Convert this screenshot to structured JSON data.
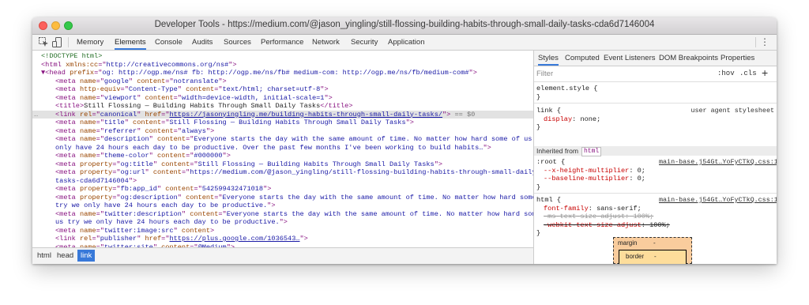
{
  "window": {
    "title": "Developer Tools - https://medium.com/@jason_yingling/still-flossing-building-habits-through-small-daily-tasks-cda6d7146004"
  },
  "toolbar": {
    "inspect_icon": "cursor-select-icon",
    "device_icon": "device-mode-icon",
    "more_icon": "kebab-menu-icon",
    "more_glyph": "⋮",
    "tabs": [
      "Memory",
      "Elements",
      "Console",
      "Audits",
      "Sources",
      "Performance",
      "Network",
      "Security",
      "Application"
    ],
    "active_tab": "Elements"
  },
  "dom": {
    "gutter_dots": "…",
    "selected_marker": "== $0",
    "lines": [
      {
        "a": "<!DOCTYPE html>"
      },
      {
        "a": "<html",
        "b": " xmlns:cc",
        "c": "=\"",
        "d": "http://creativecommons.org/ns#",
        "e": "\">"
      },
      {
        "a": "▼<head",
        "b": " prefix",
        "c": "=\"",
        "d": "og: http://ogp.me/ns# fb: http://ogp.me/ns/fb# medium-com: http://ogp.me/ns/fb/medium-com#",
        "e": "\">"
      },
      {
        "a": "<meta",
        "b": " name",
        "c": "=\"",
        "d": "google",
        "e": "\"",
        "f": " content",
        "g": "=\"",
        "h": "notranslate",
        "i": "\">"
      },
      {
        "a": "<meta",
        "b": " http-equiv",
        "c": "=\"",
        "d": "Content-Type",
        "e": "\"",
        "f": " content",
        "g": "=\"",
        "h": "text/html; charset=utf-8",
        "i": "\">"
      },
      {
        "a": "<meta",
        "b": " name",
        "c": "=\"",
        "d": "viewport",
        "e": "\"",
        "f": " content",
        "g": "=\"",
        "h": "width=device-width, initial-scale=1",
        "i": "\">"
      },
      {
        "a": "<title>",
        "b": "Still Flossing — Building Habits Through Small Daily Tasks",
        "c": "</title>"
      },
      {
        "a": "<link",
        "b": " rel",
        "c": "=\"",
        "d": "canonical",
        "e": "\"",
        "f": " href",
        "g": "=\"",
        "h": "https://jasonyingling.me/building-habits-through-small-daily-tasks/",
        "i": "\">"
      },
      {
        "a": "<meta",
        "b": " name",
        "c": "=\"",
        "d": "title",
        "e": "\"",
        "f": " content",
        "g": "=\"",
        "h": "Still Flossing — Building Habits Through Small Daily Tasks",
        "i": "\">"
      },
      {
        "a": "<meta",
        "b": " name",
        "c": "=\"",
        "d": "referrer",
        "e": "\"",
        "f": " content",
        "g": "=\"",
        "h": "always",
        "i": "\">"
      },
      {
        "a": "<meta",
        "b": " name",
        "c": "=\"",
        "d": "description",
        "e": "\"",
        "f": " content",
        "g": "=\"",
        "h": "Everyone starts the day with the same amount of time. No matter how hard some of us try we"
      },
      {
        "a": "only have 24 hours each day to be productive. Over the past few months I've been working to build habits…",
        "b": "\">"
      },
      {
        "a": "<meta",
        "b": " name",
        "c": "=\"",
        "d": "theme-color",
        "e": "\"",
        "f": " content",
        "g": "=\"",
        "h": "#000000",
        "i": "\">"
      },
      {
        "a": "<meta",
        "b": " property",
        "c": "=\"",
        "d": "og:title",
        "e": "\"",
        "f": " content",
        "g": "=\"",
        "h": "Still Flossing — Building Habits Through Small Daily Tasks",
        "i": "\">"
      },
      {
        "a": "<meta",
        "b": " property",
        "c": "=\"",
        "d": "og:url",
        "e": "\"",
        "f": " content",
        "g": "=\"",
        "h": "https://medium.com/@jason_yingling/still-flossing-building-habits-through-small-daily-"
      },
      {
        "a": "tasks-cda6d7146004",
        "b": "\">"
      },
      {
        "a": "<meta",
        "b": " property",
        "c": "=\"",
        "d": "fb:app_id",
        "e": "\"",
        "f": " content",
        "g": "=\"",
        "h": "542599432471018",
        "i": "\">"
      },
      {
        "a": "<meta",
        "b": " property",
        "c": "=\"",
        "d": "og:description",
        "e": "\"",
        "f": " content",
        "g": "=\"",
        "h": "Everyone starts the day with the same amount of time. No matter how hard some of us"
      },
      {
        "a": "try we only have 24 hours each day to be productive.",
        "b": "\">"
      },
      {
        "a": "<meta",
        "b": " name",
        "c": "=\"",
        "d": "twitter:description",
        "e": "\"",
        "f": " content",
        "g": "=\"",
        "h": "Everyone starts the day with the same amount of time. No matter how hard some of"
      },
      {
        "a": "us try we only have 24 hours each day to be productive.",
        "b": "\">"
      },
      {
        "a": "<meta",
        "b": " name",
        "c": "=\"",
        "d": "twitter:image:src",
        "e": "\"",
        "f": " content",
        "i": ">"
      },
      {
        "a": "<link",
        "b": " rel",
        "c": "=\"",
        "d": "publisher",
        "e": "\"",
        "f": " href",
        "g": "=\"",
        "h": "https://plus.google.com/1036543…",
        "i": "\">"
      },
      {
        "a": "<meta",
        "b": " name",
        "c": "=\"",
        "d": "twitter:site",
        "e": "\"",
        "f": " content",
        "g": "=\"",
        "h": "@Medium",
        "i": "\">"
      }
    ]
  },
  "breadcrumbs": [
    "html",
    "head",
    "link"
  ],
  "styles": {
    "tabs": [
      "Styles",
      "Computed",
      "Event Listeners",
      "DOM Breakpoints",
      "Properties"
    ],
    "active_tab": "Styles",
    "filter_placeholder": "Filter",
    "hov": ":hov",
    "cls": ".cls",
    "add": "+",
    "element_style": "element.style {",
    "close_brace": "}",
    "link_rule": {
      "selector": "link {",
      "origin": "user agent stylesheet",
      "prop": "display",
      "value": " none;"
    },
    "inherited_label": "Inherited from",
    "inherited_chip": "html",
    "root_rule": {
      "selector": ":root {",
      "source": "main-base.j54Gt…YoFyCTkQ.css:1",
      "decls": [
        {
          "prop": "--x-height-multiplier",
          "value": " 0;"
        },
        {
          "prop": "--baseline-multiplier",
          "value": " 0;"
        }
      ]
    },
    "html_rule": {
      "selector": "html {",
      "source": "main-base.j54Gt…YoFyCTkQ.css:1",
      "decls": [
        {
          "prop": "font-family",
          "value": " sans-serif;"
        },
        {
          "prop": "-ms-text-size-adjust",
          "value": " 100%;"
        },
        {
          "prop": "-webkit-text-size-adjust",
          "value": " 100%;"
        }
      ]
    },
    "box_model": {
      "margin_label": "margin",
      "border_label": "border",
      "dash": "-"
    }
  },
  "colors": {
    "accent": "#3879d9",
    "tag": "#881280",
    "attr_name": "#994500",
    "attr_value": "#1a1aa6",
    "css_prop": "#c80000"
  }
}
